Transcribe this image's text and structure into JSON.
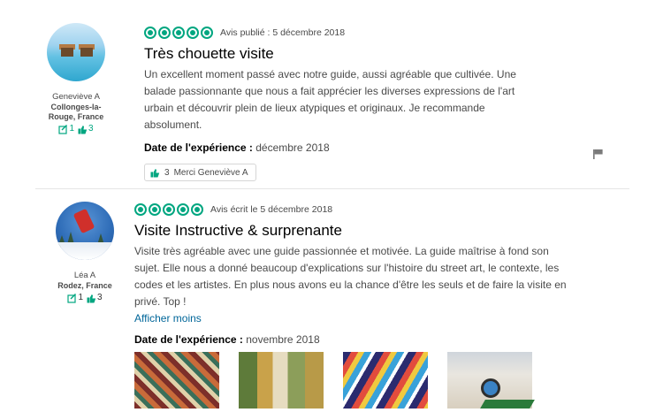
{
  "reviews": [
    {
      "member": {
        "name": "Geneviève A",
        "location": "Collonges-la-Rouge, France",
        "contributions": "1",
        "helpful_votes": "3"
      },
      "rating_bubbles": 5,
      "published": "Avis publié : 5 décembre 2018",
      "title": "Très chouette visite",
      "body": "Un excellent moment passé avec notre guide, aussi agréable que cultivée. Une balade passionnante que nous a fait apprécier les diverses expressions de l'art urbain et découvrir plein de lieux atypiques et originaux. Je recommande absolument.",
      "experience_label": "Date de l'expérience :",
      "experience_date": " décembre 2018",
      "thanks": {
        "count": "3",
        "label": "Merci Geneviève A"
      }
    },
    {
      "member": {
        "name": "Léa A",
        "location": "Rodez, France",
        "contributions": "1",
        "helpful_votes": "3"
      },
      "rating_bubbles": 5,
      "published": "Avis écrit le 5 décembre 2018",
      "title": "Visite Instructive & surprenante",
      "body": "Visite très agréable avec une guide passionnée et motivée. La guide maîtrise à fond son sujet. Elle nous a donné beaucoup d'explications sur l'histoire du street art, le contexte, les codes et les artistes. En plus nous avons eu la chance d'être les seuls et de faire la visite en privé. Top !",
      "more_link": "Afficher moins",
      "experience_label": "Date de l'expérience :",
      "experience_date": " novembre 2018",
      "photo_count": 4
    }
  ],
  "colors": {
    "bubble": "#00a680",
    "link": "#006699",
    "title": "#000000",
    "text": "#4a4a4a"
  },
  "icons": {
    "review_count": "pencil-square-icon",
    "helpful": "thumbs-up-icon",
    "report": "flag-icon"
  }
}
